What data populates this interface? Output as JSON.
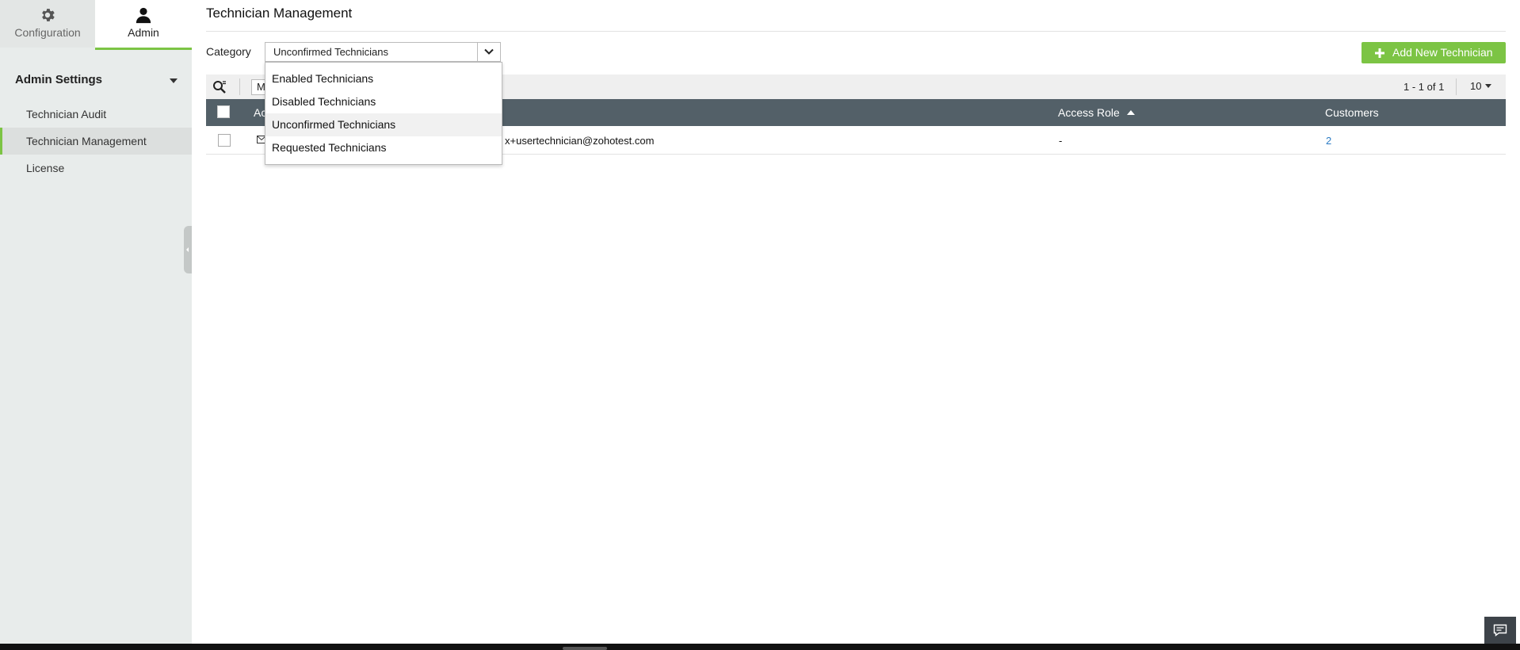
{
  "sidebar": {
    "tabs": [
      {
        "label": "Configuration",
        "icon": "gear-icon"
      },
      {
        "label": "Admin",
        "icon": "user-icon"
      }
    ],
    "section_title": "Admin Settings",
    "items": [
      {
        "label": "Technician Audit"
      },
      {
        "label": "Technician Management"
      },
      {
        "label": "License"
      }
    ]
  },
  "page": {
    "title": "Technician Management",
    "category_label": "Category",
    "category_selected": "Unconfirmed Technicians",
    "category_options": [
      "Enabled Technicians",
      "Disabled Technicians",
      "Unconfirmed Technicians",
      "Requested Technicians"
    ],
    "add_button": "Add New Technician"
  },
  "toolbar": {
    "search_text": "M",
    "pager": "1 - 1 of 1",
    "per_page": "10"
  },
  "table": {
    "headers": [
      "Ac",
      "Access Role",
      "Customers"
    ],
    "rows": [
      {
        "email": "x+usertechnician@zohotest.com",
        "access_role": "-",
        "customers": "2"
      }
    ]
  },
  "colors": {
    "accent": "#7cc444",
    "header_bg": "#536068",
    "link": "#2b7bc4"
  }
}
